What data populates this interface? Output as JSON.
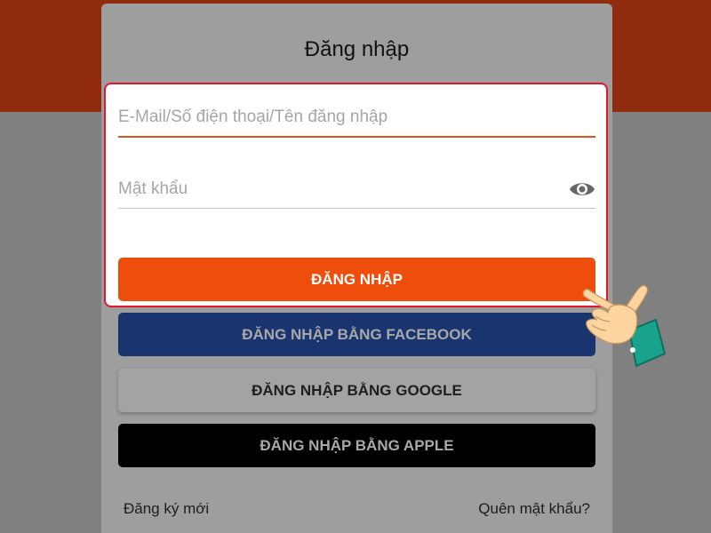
{
  "title": "Đăng nhập",
  "form": {
    "username": {
      "placeholder": "E-Mail/Số điện thoại/Tên đăng nhập",
      "value": ""
    },
    "password": {
      "placeholder": "Mật khẩu",
      "value": "",
      "toggle_icon": "eye-icon"
    }
  },
  "buttons": {
    "login": "ĐĂNG NHẬP",
    "facebook": "ĐĂNG NHẬP BẰNG FACEBOOK",
    "google": "ĐĂNG NHẬP BẰNG GOOGLE",
    "apple": "ĐĂNG NHẬP BẰNG APPLE"
  },
  "links": {
    "register": "Đăng ký mới",
    "forgot": "Quên mật khẩu?"
  },
  "colors": {
    "accent": "#ee4d0b",
    "header_band": "#8f2c0d",
    "highlight_border": "#e0182b",
    "facebook": "#19346f",
    "apple": "#000000"
  },
  "pointer_icon": "pointing-hand-icon"
}
